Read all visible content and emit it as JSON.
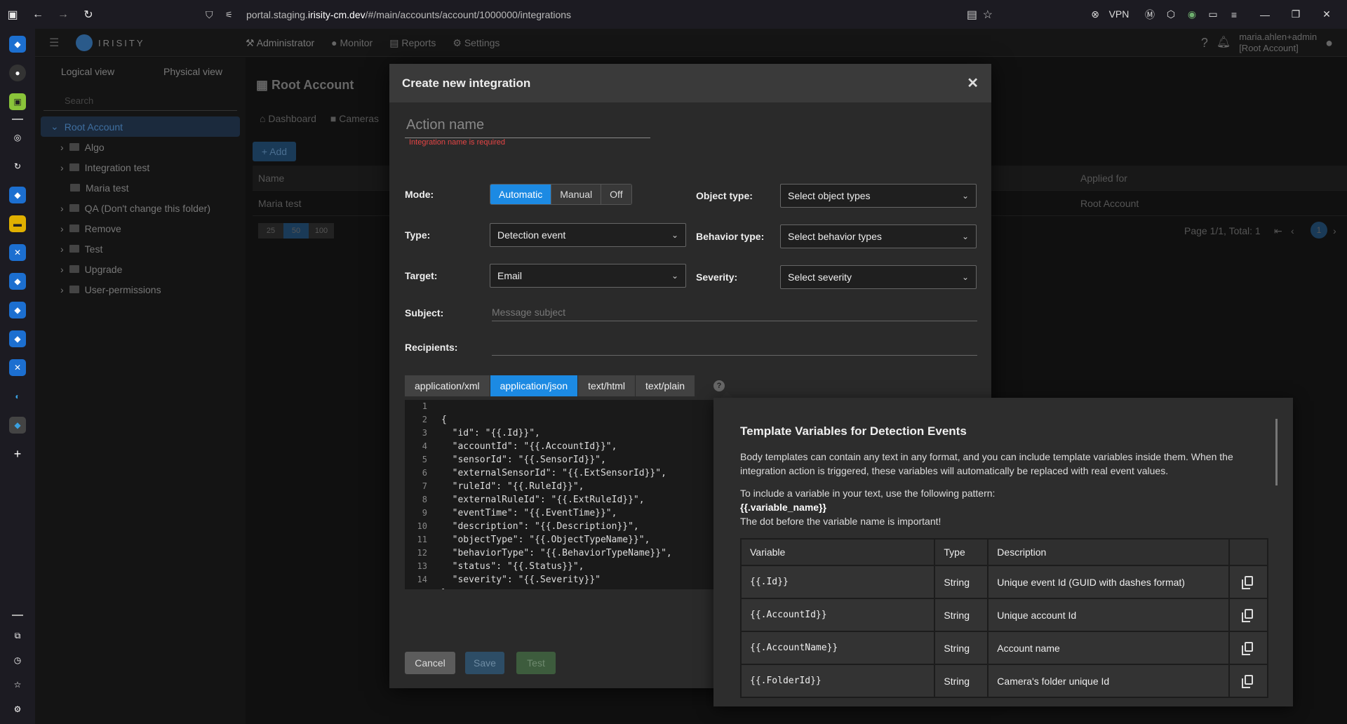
{
  "browser": {
    "url_prefix": "portal.staging.",
    "url_host": "irisity-cm.dev",
    "url_path": "/#/main/accounts/account/1000000/integrations",
    "vpn_label": "VPN"
  },
  "app": {
    "logo_text": "IRISITY",
    "nav": [
      "Administrator",
      "Monitor",
      "Reports",
      "Settings"
    ],
    "user_name": "maria.ahlen+admin",
    "user_account": "[Root Account]"
  },
  "left_panel": {
    "tabs": [
      "Logical view",
      "Physical view"
    ],
    "search_placeholder": "Search",
    "root": "Root Account",
    "folders": [
      "Algo",
      "Integration test",
      "Maria test",
      "QA (Don't change this folder)",
      "Remove",
      "Test",
      "Upgrade",
      "User-permissions"
    ]
  },
  "background": {
    "title": "Root Account",
    "tabs": [
      "Dashboard",
      "Cameras"
    ],
    "add_label": "+ Add",
    "col_name": "Name",
    "col_applied": "Applied for",
    "row_name": "Maria test",
    "row_applied": "Root Account",
    "page_sizes": [
      "25",
      "50",
      "100"
    ],
    "page_info": "Page 1/1, Total: 1",
    "page_current": "1"
  },
  "modal": {
    "title": "Create new integration",
    "action_placeholder": "Action name",
    "error": "Integration name is required",
    "mode_label": "Mode:",
    "modes": [
      "Automatic",
      "Manual",
      "Off"
    ],
    "mode_selected": "Automatic",
    "type_label": "Type:",
    "type_value": "Detection event",
    "target_label": "Target:",
    "target_value": "Email",
    "object_type_label": "Object type:",
    "object_type_value": "Select object types",
    "behavior_type_label": "Behavior type:",
    "behavior_type_value": "Select behavior types",
    "severity_label": "Severity:",
    "severity_value": "Select severity",
    "subject_label": "Subject:",
    "subject_placeholder": "Message subject",
    "recipients_label": "Recipients:",
    "content_types": [
      "application/xml",
      "application/json",
      "text/html",
      "text/plain"
    ],
    "content_type_selected": "application/json",
    "help": "?",
    "code_lines": [
      "",
      "{",
      "  \"id\": \"{{.Id}}\",",
      "  \"accountId\": \"{{.AccountId}}\",",
      "  \"sensorId\": \"{{.SensorId}}\",",
      "  \"externalSensorId\": \"{{.ExtSensorId}}\",",
      "  \"ruleId\": \"{{.RuleId}}\",",
      "  \"externalRuleId\": \"{{.ExtRuleId}}\",",
      "  \"eventTime\": \"{{.EventTime}}\",",
      "  \"description\": \"{{.Description}}\",",
      "  \"objectType\": \"{{.ObjectTypeName}}\",",
      "  \"behaviorType\": \"{{.BehaviorTypeName}}\",",
      "  \"status\": \"{{.Status}}\",",
      "  \"severity\": \"{{.Severity}}\"",
      "}"
    ],
    "cancel_label": "Cancel",
    "save_label": "Save",
    "test_label": "Test"
  },
  "tooltip": {
    "title": "Template Variables for Detection Events",
    "intro": "Body templates can contain any text in any format, and you can include template variables inside them. When the integration action is triggered, these variables will automatically be replaced with real event values.",
    "pattern_intro": "To include a variable in your text, use the following pattern:",
    "pattern": "{{.variable_name}}",
    "note": "The dot before the variable name is important!",
    "col_variable": "Variable",
    "col_type": "Type",
    "col_description": "Description",
    "rows": [
      {
        "variable": "{{.Id}}",
        "type": "String",
        "description": "Unique event Id (GUID with dashes format)"
      },
      {
        "variable": "{{.AccountId}}",
        "type": "String",
        "description": "Unique account Id"
      },
      {
        "variable": "{{.AccountName}}",
        "type": "String",
        "description": "Account name"
      },
      {
        "variable": "{{.FolderId}}",
        "type": "String",
        "description": "Camera's folder unique Id"
      }
    ]
  },
  "colors": {
    "accent": "#1c8ae3",
    "error": "#e64545"
  }
}
